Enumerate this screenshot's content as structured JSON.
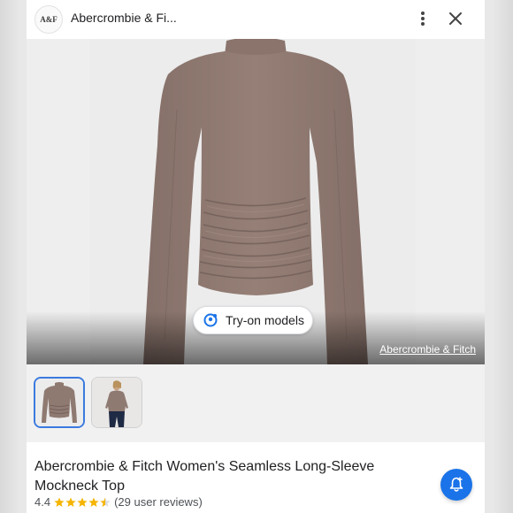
{
  "header": {
    "logo_text": "A&F",
    "site_title": "Abercrombie & Fi...",
    "more_icon": "more-vert-icon",
    "close_icon": "close-icon"
  },
  "hero": {
    "try_on_label": "Try-on models",
    "try_on_icon": "try-on-models-icon",
    "source_link": "Abercrombie & Fitch",
    "product_color": "#907a72"
  },
  "thumbnails": [
    {
      "name": "thumbnail-product-shirt",
      "selected": true
    },
    {
      "name": "thumbnail-model-wearing",
      "selected": false
    }
  ],
  "product": {
    "title": "Abercrombie & Fitch Women's Seamless Long-Sleeve Mockneck Top",
    "rating": "4.4",
    "stars": 4.5,
    "reviews": "(29 user reviews)",
    "alert_icon": "price-alert-bell-icon"
  },
  "colors": {
    "accent": "#1a73e8",
    "star": "#f4b400",
    "selected_border": "#3b7ae0"
  }
}
